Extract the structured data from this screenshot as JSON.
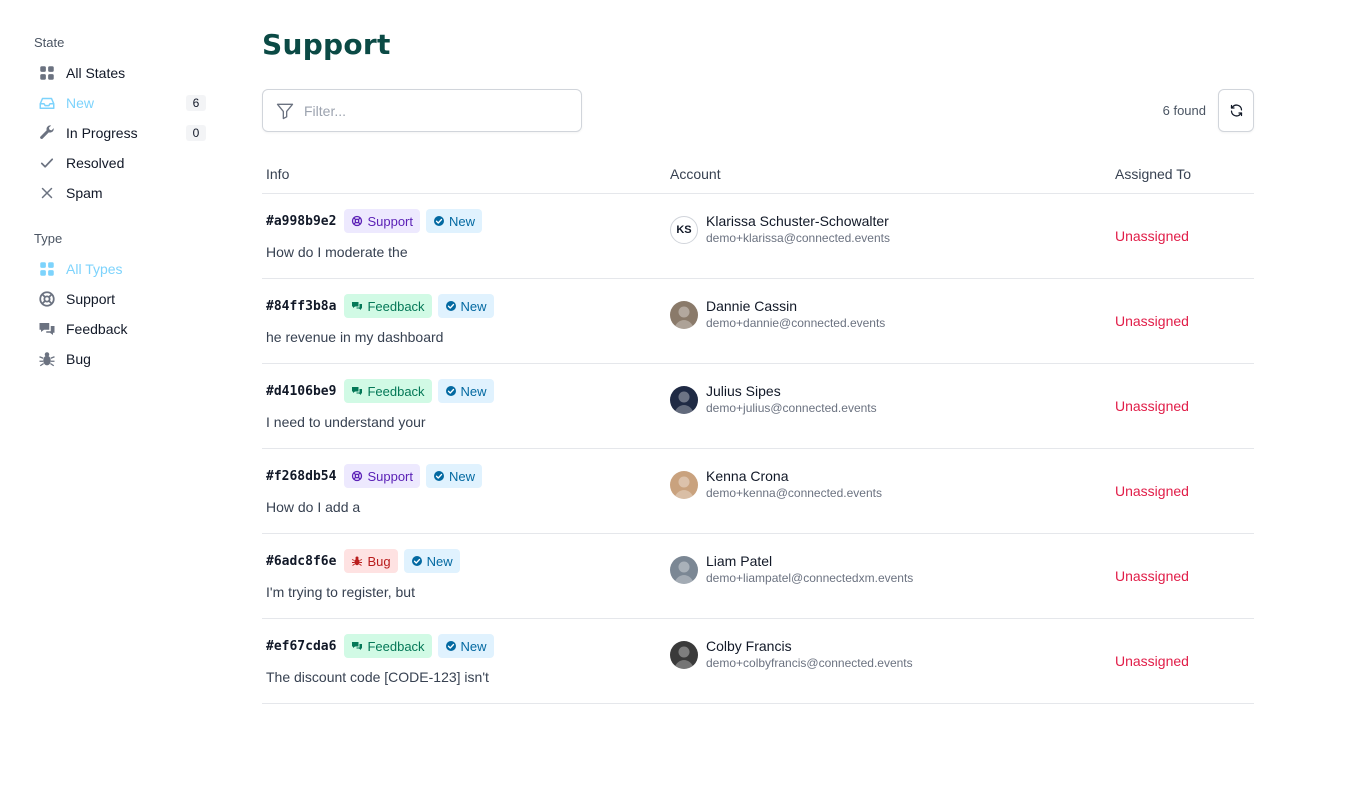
{
  "sidebar": {
    "state_title": "State",
    "states": [
      {
        "label": "All States",
        "icon": "grid-icon",
        "count": null,
        "active": false
      },
      {
        "label": "New",
        "icon": "inbox-icon",
        "count": "6",
        "active": true
      },
      {
        "label": "In Progress",
        "icon": "wrench-icon",
        "count": "0",
        "active": false
      },
      {
        "label": "Resolved",
        "icon": "check-icon",
        "count": null,
        "active": false
      },
      {
        "label": "Spam",
        "icon": "x-icon",
        "count": null,
        "active": false
      }
    ],
    "type_title": "Type",
    "types": [
      {
        "label": "All Types",
        "icon": "grid-icon",
        "active": true
      },
      {
        "label": "Support",
        "icon": "lifebuoy-icon",
        "active": false
      },
      {
        "label": "Feedback",
        "icon": "chat-bubbles-icon",
        "active": false
      },
      {
        "label": "Bug",
        "icon": "bug-icon",
        "active": false
      }
    ]
  },
  "main": {
    "title": "Support",
    "filter_placeholder": "Filter...",
    "filter_value": "",
    "found_text": "6 found"
  },
  "table": {
    "columns": {
      "info": "Info",
      "account": "Account",
      "assigned": "Assigned To"
    },
    "rows": [
      {
        "id": "#a998b9e2",
        "type": "Support",
        "status": "New",
        "snippet": "How do I moderate the",
        "name": "Klarissa Schuster-Schowalter",
        "email": "demo+klarissa@connected.events",
        "initials": "KS",
        "avatar_color": "",
        "assigned": "Unassigned"
      },
      {
        "id": "#84ff3b8a",
        "type": "Feedback",
        "status": "New",
        "snippet": "he revenue in my dashboard",
        "name": "Dannie Cassin",
        "email": "demo+dannie@connected.events",
        "initials": "",
        "avatar_color": "#8a7a6a",
        "assigned": "Unassigned"
      },
      {
        "id": "#d4106be9",
        "type": "Feedback",
        "status": "New",
        "snippet": "I need to understand your",
        "name": "Julius Sipes",
        "email": "demo+julius@connected.events",
        "initials": "",
        "avatar_color": "#1f2a44",
        "assigned": "Unassigned"
      },
      {
        "id": "#f268db54",
        "type": "Support",
        "status": "New",
        "snippet": "How do I add a",
        "name": "Kenna Crona",
        "email": "demo+kenna@connected.events",
        "initials": "",
        "avatar_color": "#c9a27e",
        "assigned": "Unassigned"
      },
      {
        "id": "#6adc8f6e",
        "type": "Bug",
        "status": "New",
        "snippet": "I'm trying to register, but",
        "name": "Liam Patel",
        "email": "demo+liampatel@connectedxm.events",
        "initials": "",
        "avatar_color": "#7b8794",
        "assigned": "Unassigned"
      },
      {
        "id": "#ef67cda6",
        "type": "Feedback",
        "status": "New",
        "snippet": "The discount code [CODE-123] isn't",
        "name": "Colby Francis",
        "email": "demo+colbyfrancis@connected.events",
        "initials": "",
        "avatar_color": "#3a3a3a",
        "assigned": "Unassigned"
      }
    ]
  }
}
